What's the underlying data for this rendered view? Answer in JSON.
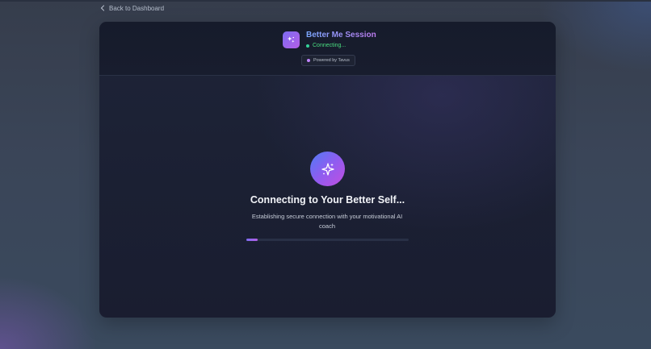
{
  "nav": {
    "back_label": "Back to Dashboard",
    "back_icon": "chevron-left-icon"
  },
  "session": {
    "title": "Better Me Session",
    "status": "Connecting...",
    "status_color": "#34d399",
    "powered_by": "Powered by Tavus",
    "app_icon": "sparkles-icon"
  },
  "main": {
    "avatar_icon": "sparkles-icon",
    "heading": "Connecting to Your Better Self...",
    "subtext": "Establishing secure connection with your motivational AI coach",
    "progress": 0.07
  },
  "colors": {
    "accent_start": "#7c6cf0",
    "accent_end": "#b45ee6",
    "card_background": "#1b2033",
    "page_background": "#3a4558"
  }
}
